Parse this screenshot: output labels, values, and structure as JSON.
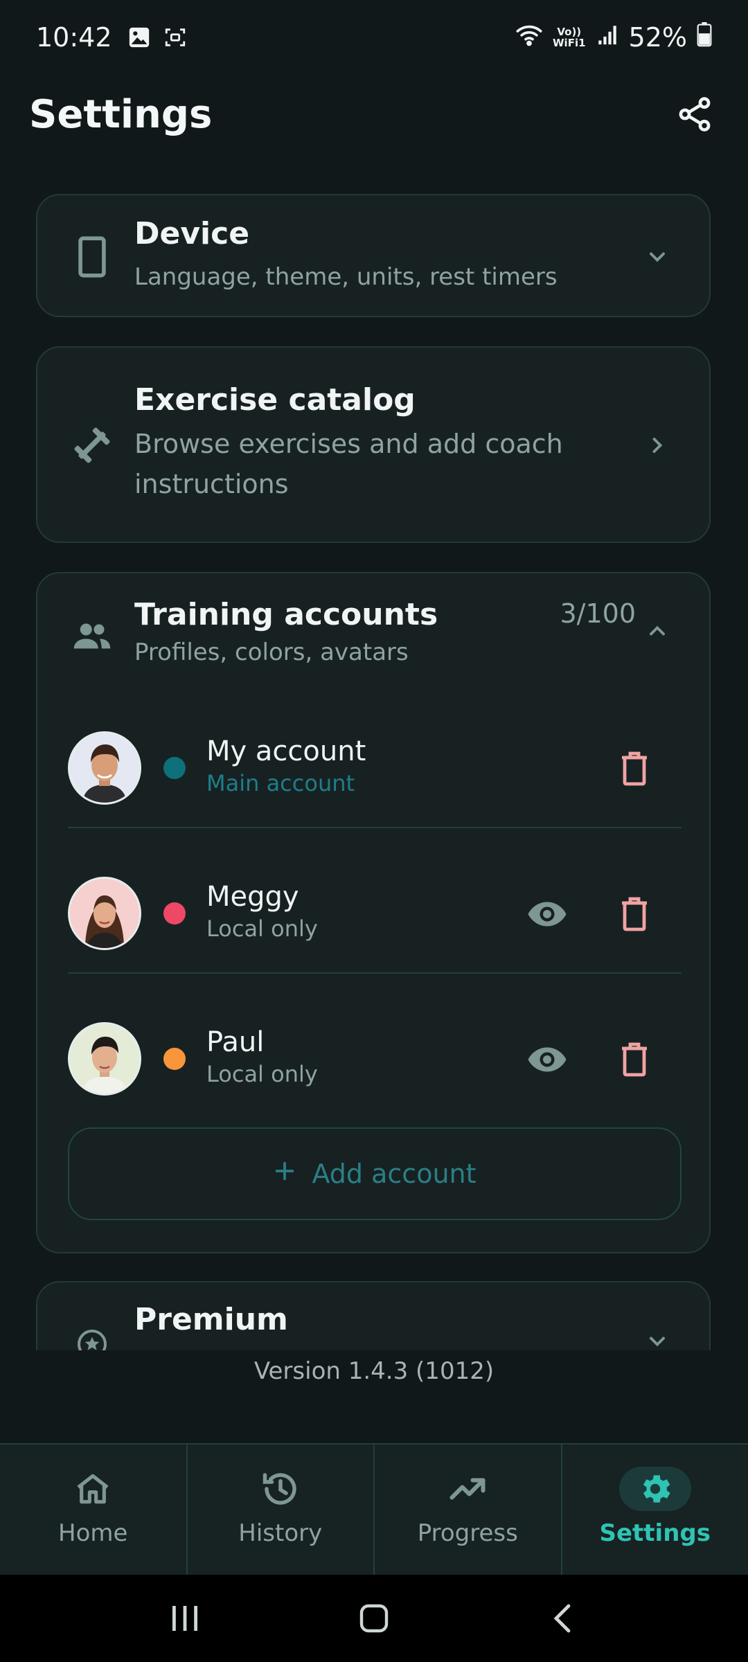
{
  "status_bar": {
    "time": "10:42",
    "volte_top": "Vo))",
    "volte_bottom": "WiFi1",
    "battery": "52%"
  },
  "header": {
    "title": "Settings",
    "share_icon": "share-icon"
  },
  "cards": {
    "device": {
      "title": "Device",
      "subtitle": "Language, theme, units, rest timers",
      "icon": "phone-icon"
    },
    "exercise_catalog": {
      "title": "Exercise catalog",
      "subtitle": "Browse exercises and add coach instructions",
      "icon": "dumbbell-icon"
    },
    "training_accounts": {
      "title": "Training accounts",
      "subtitle": "Profiles, colors, avatars",
      "count": "3/100",
      "icon": "people-icon",
      "accounts": [
        {
          "name": "My account",
          "role": "Main account",
          "dot_color": "#0f6f7a",
          "role_color": "#1d7e8a",
          "show_eye": false
        },
        {
          "name": "Meggy",
          "role": "Local only",
          "dot_color": "#ef4864",
          "role_color": "#8fa3a2",
          "show_eye": true
        },
        {
          "name": "Paul",
          "role": "Local only",
          "dot_color": "#f9963a",
          "role_color": "#8fa3a2",
          "show_eye": true
        }
      ],
      "add_button": "Add account"
    },
    "premium": {
      "title": "Premium",
      "icon": "star-badge-icon"
    }
  },
  "version": "Version 1.4.3 (1012)",
  "nav": {
    "items": [
      {
        "label": "Home",
        "icon": "home-icon"
      },
      {
        "label": "History",
        "icon": "history-icon"
      },
      {
        "label": "Progress",
        "icon": "trending-up-icon"
      },
      {
        "label": "Settings",
        "icon": "gear-icon"
      }
    ],
    "active": "Settings"
  },
  "colors": {
    "accent": "#2fc3b4",
    "danger_icon": "#f1a3a3",
    "muted_icon": "#7e9694"
  }
}
